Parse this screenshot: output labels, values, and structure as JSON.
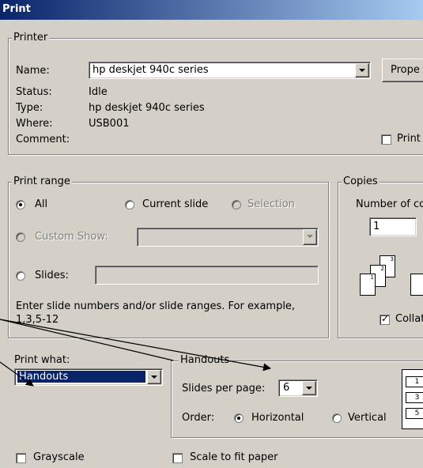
{
  "window": {
    "title": "Print"
  },
  "printer": {
    "group_label": "Printer",
    "name_label": "Name:",
    "name_value": "hp deskjet 940c series",
    "properties_label": "Prope",
    "status_label": "Status:",
    "status_value": "Idle",
    "type_label": "Type:",
    "type_value": "hp deskjet 940c series",
    "where_label": "Where:",
    "where_value": "USB001",
    "comment_label": "Comment:",
    "print_to_file_label": "Print"
  },
  "print_range": {
    "group_label": "Print range",
    "all_label": "All",
    "current_slide_label": "Current slide",
    "selection_label": "Selection",
    "custom_show_label": "Custom Show:",
    "slides_label": "Slides:",
    "hint": "Enter slide numbers and/or slide ranges. For example,",
    "hint_example": "1,3,5-12",
    "selected": "All"
  },
  "copies": {
    "group_label": "Copies",
    "number_label": "Number of co",
    "number_value": "1",
    "collate_label": "Collat",
    "collate_checked": true,
    "page_icons": [
      "1",
      "2",
      "3"
    ]
  },
  "print_what": {
    "label": "Print what:",
    "value": "Handouts"
  },
  "handouts": {
    "group_label": "Handouts",
    "slides_per_page_label": "Slides per page:",
    "slides_per_page_value": "6",
    "order_label": "Order:",
    "horizontal_label": "Horizontal",
    "vertical_label": "Vertical",
    "order_selected": "Horizontal",
    "preview_numbers": [
      "1",
      "3",
      "5"
    ]
  },
  "options": {
    "grayscale_label": "Grayscale",
    "scale_to_fit_label": "Scale to fit paper"
  }
}
